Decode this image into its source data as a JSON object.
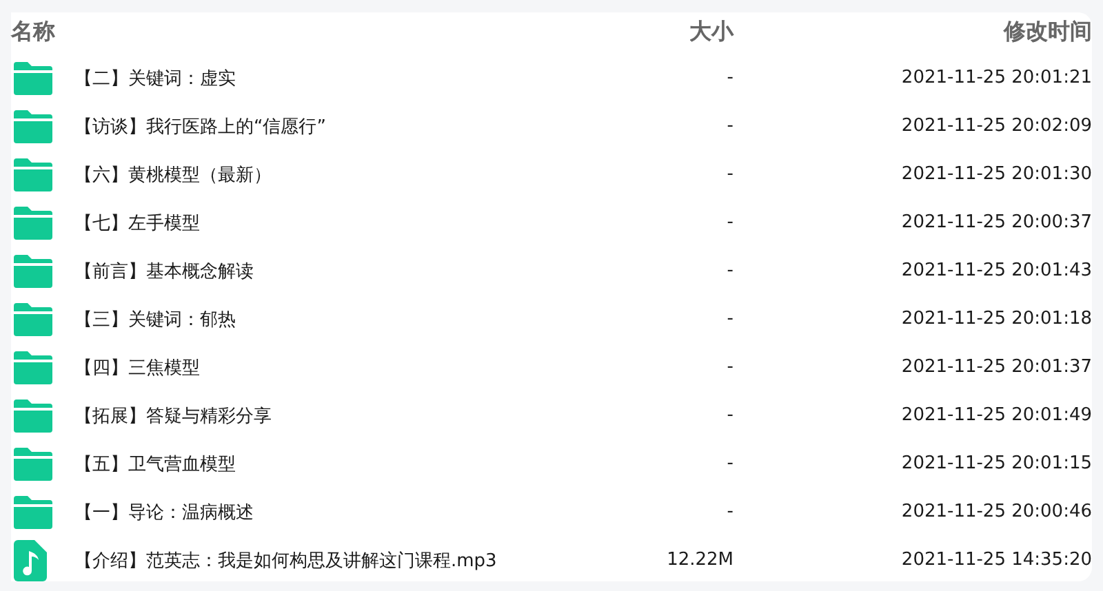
{
  "table": {
    "columns": [
      "名称",
      "大小",
      "修改时间"
    ],
    "rows": [
      {
        "kind": "folder",
        "name": "【二】关键词：虚实",
        "size": "-",
        "modified": "2021-11-25 20:01:21"
      },
      {
        "kind": "folder",
        "name": "【访谈】我行医路上的“信愿行”",
        "size": "-",
        "modified": "2021-11-25 20:02:09"
      },
      {
        "kind": "folder",
        "name": "【六】黄桃模型（最新）",
        "size": "-",
        "modified": "2021-11-25 20:01:30"
      },
      {
        "kind": "folder",
        "name": "【七】左手模型",
        "size": "-",
        "modified": "2021-11-25 20:00:37"
      },
      {
        "kind": "folder",
        "name": "【前言】基本概念解读",
        "size": "-",
        "modified": "2021-11-25 20:01:43"
      },
      {
        "kind": "folder",
        "name": "【三】关键词：郁热",
        "size": "-",
        "modified": "2021-11-25 20:01:18"
      },
      {
        "kind": "folder",
        "name": "【四】三焦模型",
        "size": "-",
        "modified": "2021-11-25 20:01:37"
      },
      {
        "kind": "folder",
        "name": "【拓展】答疑与精彩分享",
        "size": "-",
        "modified": "2021-11-25 20:01:49"
      },
      {
        "kind": "folder",
        "name": "【五】卫气营血模型",
        "size": "-",
        "modified": "2021-11-25 20:01:15"
      },
      {
        "kind": "folder",
        "name": "【一】导论：温病概述",
        "size": "-",
        "modified": "2021-11-25 20:00:46"
      },
      {
        "kind": "audio",
        "name": "【介绍】范英志：我是如何构思及讲解这门课程.mp3",
        "size": "12.22M",
        "modified": "2021-11-25 14:35:20"
      }
    ]
  }
}
